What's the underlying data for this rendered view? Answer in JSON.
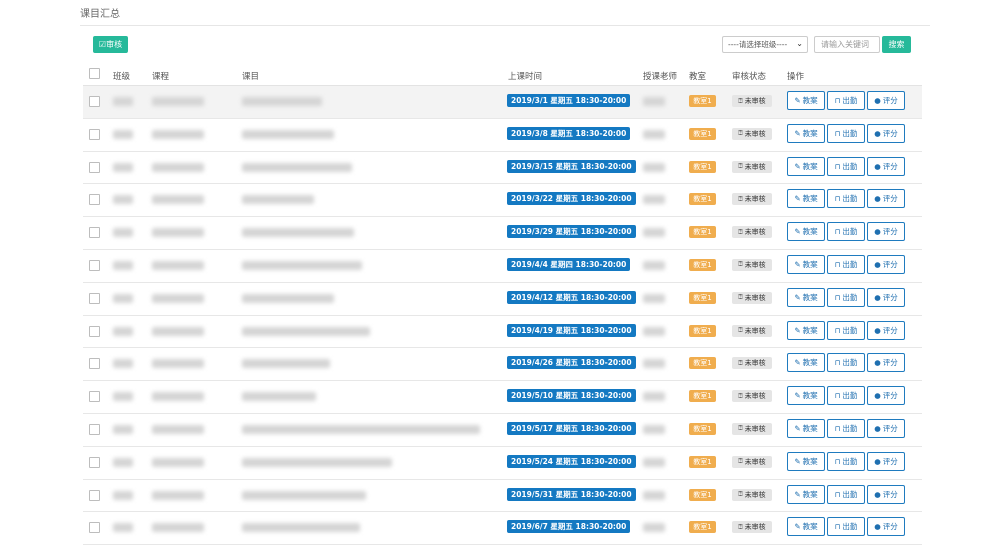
{
  "page": {
    "title": "课目汇总"
  },
  "toolbar": {
    "review_label": "审核",
    "class_select_value": "----请选择班级----",
    "search_placeholder": "请输入关键词",
    "search_label": "搜索"
  },
  "table": {
    "headers": {
      "class": "班级",
      "course": "课程",
      "subject": "课目",
      "time": "上课时间",
      "teacher": "授课老师",
      "room": "教室",
      "status": "审核状态",
      "actions": "操作"
    },
    "action_labels": {
      "plan": "教案",
      "attendance": "出勤",
      "score": "评分"
    },
    "rows": [
      {
        "class": "",
        "course": "",
        "subject": "",
        "teacher": "",
        "time": "2019/3/1 星期五 18:30-20:00",
        "room": "教室1",
        "status": "未审核"
      },
      {
        "class": "",
        "course": "",
        "subject": "",
        "teacher": "",
        "time": "2019/3/8 星期五 18:30-20:00",
        "room": "教室1",
        "status": "未审核"
      },
      {
        "class": "",
        "course": "",
        "subject": "",
        "teacher": "",
        "time": "2019/3/15 星期五 18:30-20:00",
        "room": "教室1",
        "status": "未审核"
      },
      {
        "class": "",
        "course": "",
        "subject": "",
        "teacher": "",
        "time": "2019/3/22 星期五 18:30-20:00",
        "room": "教室1",
        "status": "未审核"
      },
      {
        "class": "",
        "course": "",
        "subject": "",
        "teacher": "",
        "time": "2019/3/29 星期五 18:30-20:00",
        "room": "教室1",
        "status": "未审核"
      },
      {
        "class": "",
        "course": "",
        "subject": "",
        "teacher": "",
        "time": "2019/4/4 星期四 18:30-20:00",
        "room": "教室1",
        "status": "未审核"
      },
      {
        "class": "",
        "course": "",
        "subject": "",
        "teacher": "",
        "time": "2019/4/12 星期五 18:30-20:00",
        "room": "教室1",
        "status": "未审核"
      },
      {
        "class": "",
        "course": "",
        "subject": "",
        "teacher": "",
        "time": "2019/4/19 星期五 18:30-20:00",
        "room": "教室1",
        "status": "未审核"
      },
      {
        "class": "",
        "course": "",
        "subject": "",
        "teacher": "",
        "time": "2019/4/26 星期五 18:30-20:00",
        "room": "教室1",
        "status": "未审核"
      },
      {
        "class": "",
        "course": "",
        "subject": "",
        "teacher": "",
        "time": "2019/5/10 星期五 18:30-20:00",
        "room": "教室1",
        "status": "未审核"
      },
      {
        "class": "",
        "course": "",
        "subject": "",
        "teacher": "",
        "time": "2019/5/17 星期五 18:30-20:00",
        "room": "教室1",
        "status": "未审核"
      },
      {
        "class": "",
        "course": "",
        "subject": "",
        "teacher": "",
        "time": "2019/5/24 星期五 18:30-20:00",
        "room": "教室1",
        "status": "未审核"
      },
      {
        "class": "",
        "course": "",
        "subject": "",
        "teacher": "",
        "time": "2019/5/31 星期五 18:30-20:00",
        "room": "教室1",
        "status": "未审核"
      },
      {
        "class": "",
        "course": "",
        "subject": "",
        "teacher": "",
        "time": "2019/6/7 星期五 18:30-20:00",
        "room": "教室1",
        "status": "未审核"
      }
    ]
  },
  "colors": {
    "accent_green": "#26b99a",
    "time_blue": "#1479c2",
    "room_orange": "#f0ad4e",
    "button_border": "#1f7bbf"
  },
  "icons": {
    "review": "edit-icon",
    "status": "question-circle-icon",
    "plan": "edit-icon",
    "attendance": "lock-icon",
    "score": "user-icon"
  }
}
